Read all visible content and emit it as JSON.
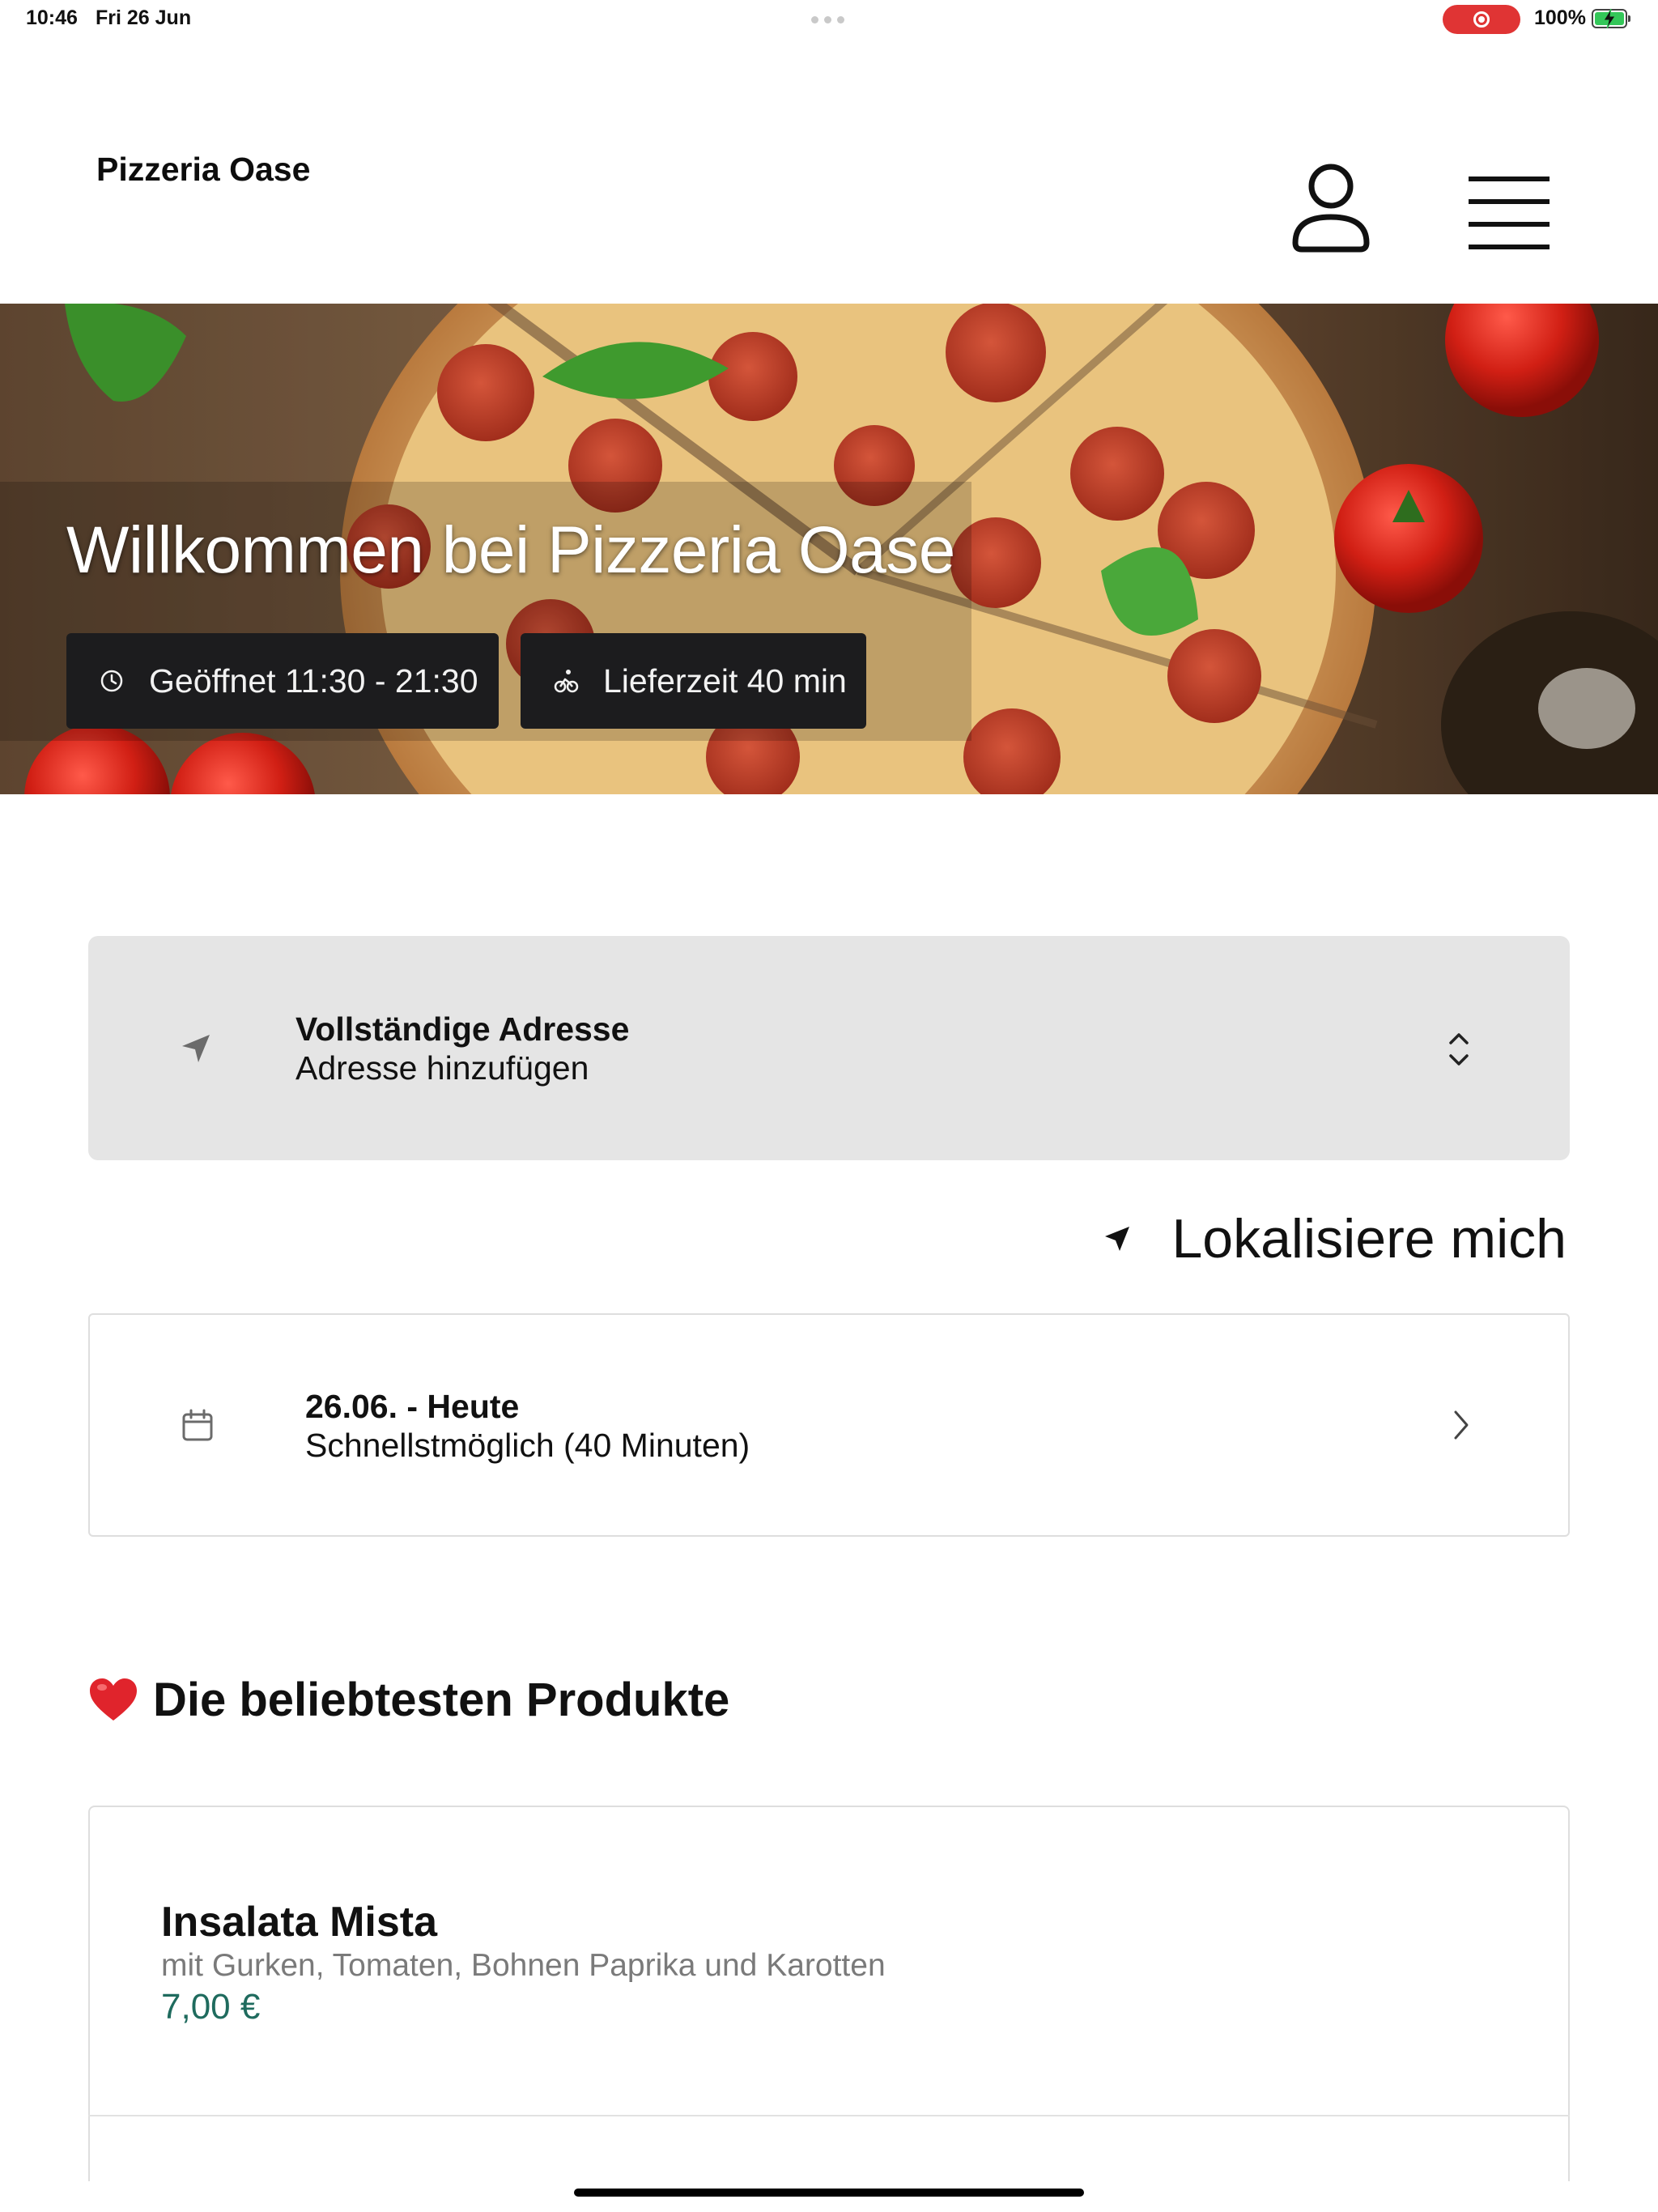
{
  "status_bar": {
    "time": "10:46",
    "date": "Fri 26 Jun",
    "battery": "100%",
    "recording_color": "#e03434"
  },
  "header": {
    "brand": "Pizzeria Oase",
    "profile_icon": "user-icon",
    "menu_icon": "hamburger-menu-icon"
  },
  "hero": {
    "title": "Willkommen bei Pizzeria Oase",
    "opening_hours": "Geöffnet 11:30 - 21:30",
    "delivery_time": "Lieferzeit 40 min",
    "chip_color": "#1c1c1e"
  },
  "address": {
    "title": "Vollständige Adresse",
    "subtitle": "Adresse hinzufügen",
    "icon": "location-arrow-icon",
    "selector_icon": "chevron-up-down-icon",
    "background": "#e5e5e5"
  },
  "locate": {
    "label": "Lokalisiere mich",
    "icon": "location-arrow-icon"
  },
  "delivery_date": {
    "title": "26.06. - Heute",
    "subtitle": "Schnellstmöglich (40 Minuten)",
    "icon": "calendar-icon",
    "chevron_icon": "chevron-right-icon"
  },
  "popular": {
    "title": "Die beliebtesten Produkte",
    "icon": "red-heart-icon",
    "products": [
      {
        "name": "Insalata Mista",
        "description": "mit Gurken, Tomaten, Bohnen Paprika und Karotten",
        "price": "7,00 €"
      }
    ],
    "price_color": "#1f6b5e"
  }
}
